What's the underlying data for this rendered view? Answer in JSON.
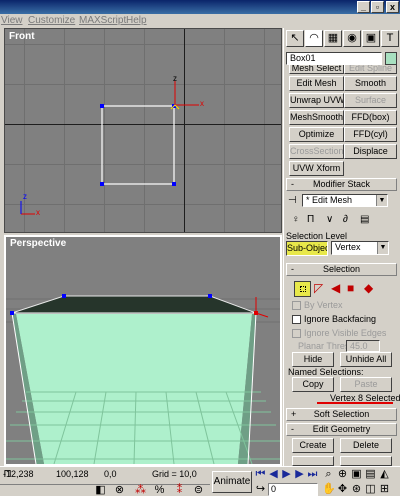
{
  "menu": [
    "View",
    "Customize",
    "MAXScript",
    "Help"
  ],
  "window_buttons": [
    "_",
    "▫",
    "x"
  ],
  "viewports": {
    "front": "Front",
    "perspective": "Perspective"
  },
  "axis": {
    "x": "x",
    "y": "y",
    "z": "z"
  },
  "command_panel": {
    "object_name": "Box01",
    "object_color": "#a8e0c0",
    "modifier_buttons": [
      [
        "Mesh Select",
        "Edit Spline"
      ],
      [
        "Edit Mesh",
        "Smooth"
      ],
      [
        "Unwrap UVW",
        "Surface"
      ],
      [
        "MeshSmooth",
        "FFD(box)"
      ],
      [
        "Optimize",
        "FFD(cyl)"
      ],
      [
        "CrossSection",
        "Displace"
      ],
      [
        "UVW Xform",
        ""
      ]
    ],
    "modifier_stack": {
      "title": "Modifier Stack",
      "current": "* Edit Mesh",
      "selection_level_label": "Selection Level",
      "sub_object": "Sub-Object",
      "level": "Vertex"
    },
    "selection": {
      "title": "Selection",
      "by_vertex": "By Vertex",
      "ignore_backfacing": "Ignore Backfacing",
      "ignore_visible_edges": "Ignore Visible Edges",
      "planar_thresh_label": "Planar Thresh",
      "planar_thresh_value": "45.0",
      "hide": "Hide",
      "unhide_all": "Unhide All",
      "named_selections": "Named Selections:",
      "copy": "Copy",
      "paste": "Paste",
      "status": "Vertex 8 Selected"
    },
    "soft_selection": "Soft Selection",
    "edit_geometry": {
      "title": "Edit Geometry",
      "create": "Create",
      "delete": "Delete"
    }
  },
  "status_bar": {
    "x": "-12,238",
    "y": "100,128",
    "z": "0,0",
    "grid": "Grid = 10,0",
    "animate": "Animate",
    "frame": "0"
  }
}
